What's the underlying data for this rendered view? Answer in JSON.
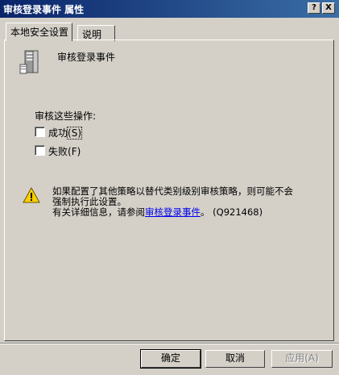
{
  "window": {
    "title": "审核登录事件 属性",
    "help_button": "?",
    "close_button": "X"
  },
  "tabs": [
    {
      "label": "本地安全设置",
      "active": true
    },
    {
      "label": "说明",
      "active": false
    }
  ],
  "policy": {
    "icon": "server-icon",
    "name": "审核登录事件"
  },
  "audit": {
    "heading": "审核这些操作:",
    "options": [
      {
        "label": "成功",
        "accel": "(S)",
        "checked": false
      },
      {
        "label": "失败",
        "accel": "(F)",
        "checked": false
      }
    ]
  },
  "warning": {
    "icon": "warning-icon",
    "line1": "如果配置了其他策略以替代类别级别审核策略，则可能不会",
    "line2": "强制执行此设置。",
    "line3_prefix": "有关详细信息，请参阅",
    "link_text": "审核登录事件",
    "line3_suffix": "。 (Q921468)"
  },
  "buttons": {
    "ok": "确定",
    "cancel": "取消",
    "apply": "应用(A)"
  }
}
